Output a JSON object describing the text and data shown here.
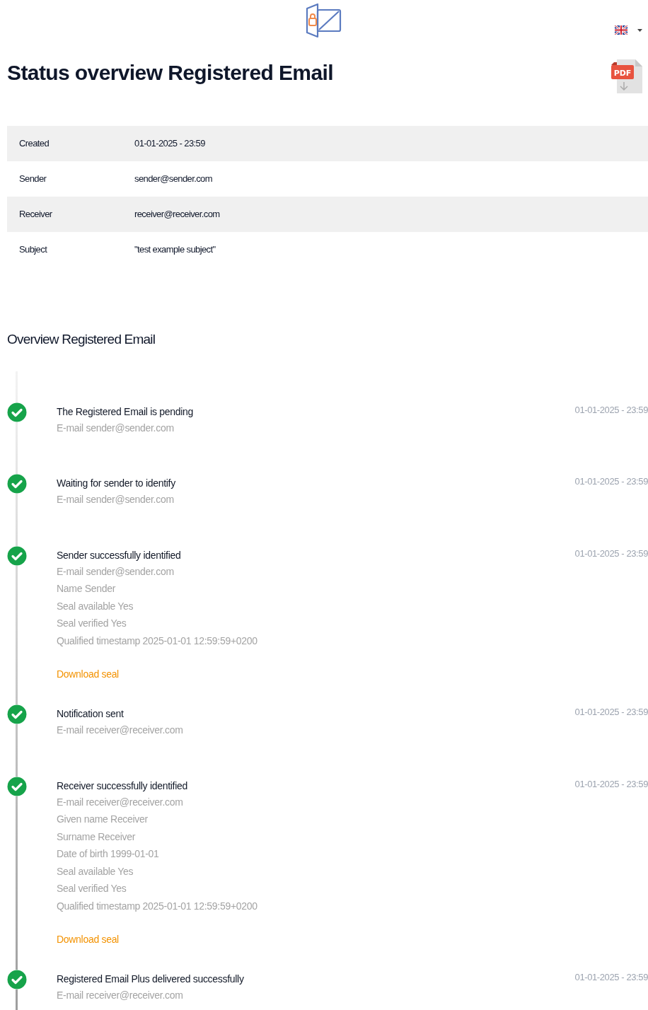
{
  "header": {
    "title": "Status overview Registered Email",
    "pdf_icon_label": "PDF"
  },
  "details": [
    {
      "label": "Created",
      "value": "01-01-2025 - 23:59"
    },
    {
      "label": "Sender",
      "value": "sender@sender.com"
    },
    {
      "label": "Receiver",
      "value": "receiver@receiver.com"
    },
    {
      "label": "Subject",
      "value": "\"test example subject\""
    }
  ],
  "overview": {
    "title": "Overview Registered Email",
    "events": [
      {
        "title": "The Registered Email is pending",
        "date": "01-01-2025 - 23:59",
        "completed": true,
        "details": [
          "E-mail sender@sender.com"
        ]
      },
      {
        "title": "Waiting for sender to identify",
        "date": "01-01-2025 - 23:59",
        "completed": true,
        "details": [
          "E-mail sender@sender.com"
        ]
      },
      {
        "title": "Sender successfully identified",
        "date": "01-01-2025 - 23:59",
        "completed": true,
        "details": [
          "E-mail sender@sender.com",
          "Name Sender",
          "Seal available Yes",
          "Seal verified Yes",
          "Qualified timestamp 2025-01-01 12:59:59+0200"
        ],
        "link": "Download seal"
      },
      {
        "title": "Notification sent",
        "date": "01-01-2025 - 23:59",
        "completed": true,
        "details": [
          "E-mail receiver@receiver.com"
        ]
      },
      {
        "title": "Receiver successfully identified",
        "date": "01-01-2025 - 23:59",
        "completed": true,
        "details": [
          "E-mail receiver@receiver.com",
          "Given name Receiver",
          "Surname Receiver",
          "Date of birth 1999-01-01",
          "Seal available Yes",
          "Seal verified Yes",
          "Qualified timestamp 2025-01-01 12:59:59+0200"
        ],
        "link": "Download seal"
      },
      {
        "title": "Registered Email Plus delivered successfully",
        "date": "01-01-2025 - 23:59",
        "completed": true,
        "details": [
          "E-mail receiver@receiver.com"
        ]
      }
    ]
  }
}
